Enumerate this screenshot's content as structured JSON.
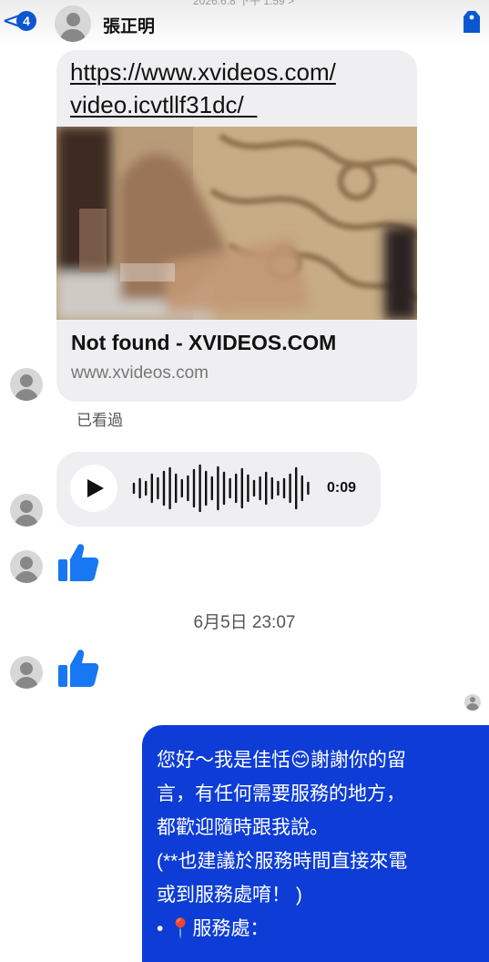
{
  "header": {
    "back_label": "<",
    "unread_count": "4",
    "contact_name": "張正明",
    "status_time": "2026.6.8 下午 1:59 >"
  },
  "link_message": {
    "url_line1": "https://www.xvideos.com/",
    "url_line2": "video.icvtllf31dc/_",
    "preview_title": "Not found - XVIDEOS.COM",
    "preview_domain": "www.xvideos.com"
  },
  "seen_label": "已看過",
  "voice_message": {
    "duration": "0:09"
  },
  "timestamp": "6月5日 23:07",
  "outgoing_message": {
    "lines": [
      "您好～我是佳恬😊謝謝你的留",
      "言，有任何需要服務的地方，",
      "都歡迎隨時跟我說。",
      "(**也建議於服務時間直接來電",
      "或到服務處唷！ )",
      " • 📍服務處："
    ]
  },
  "colors": {
    "accent": "#0b57d0",
    "outgoing_bubble": "#0d3cd6",
    "incoming_bubble": "#efeff1",
    "like_thumb": "#1877f2"
  },
  "icons": {
    "back": "chevron-left-icon",
    "tag": "tag-icon",
    "play": "play-icon",
    "like": "thumbs-up-icon"
  }
}
